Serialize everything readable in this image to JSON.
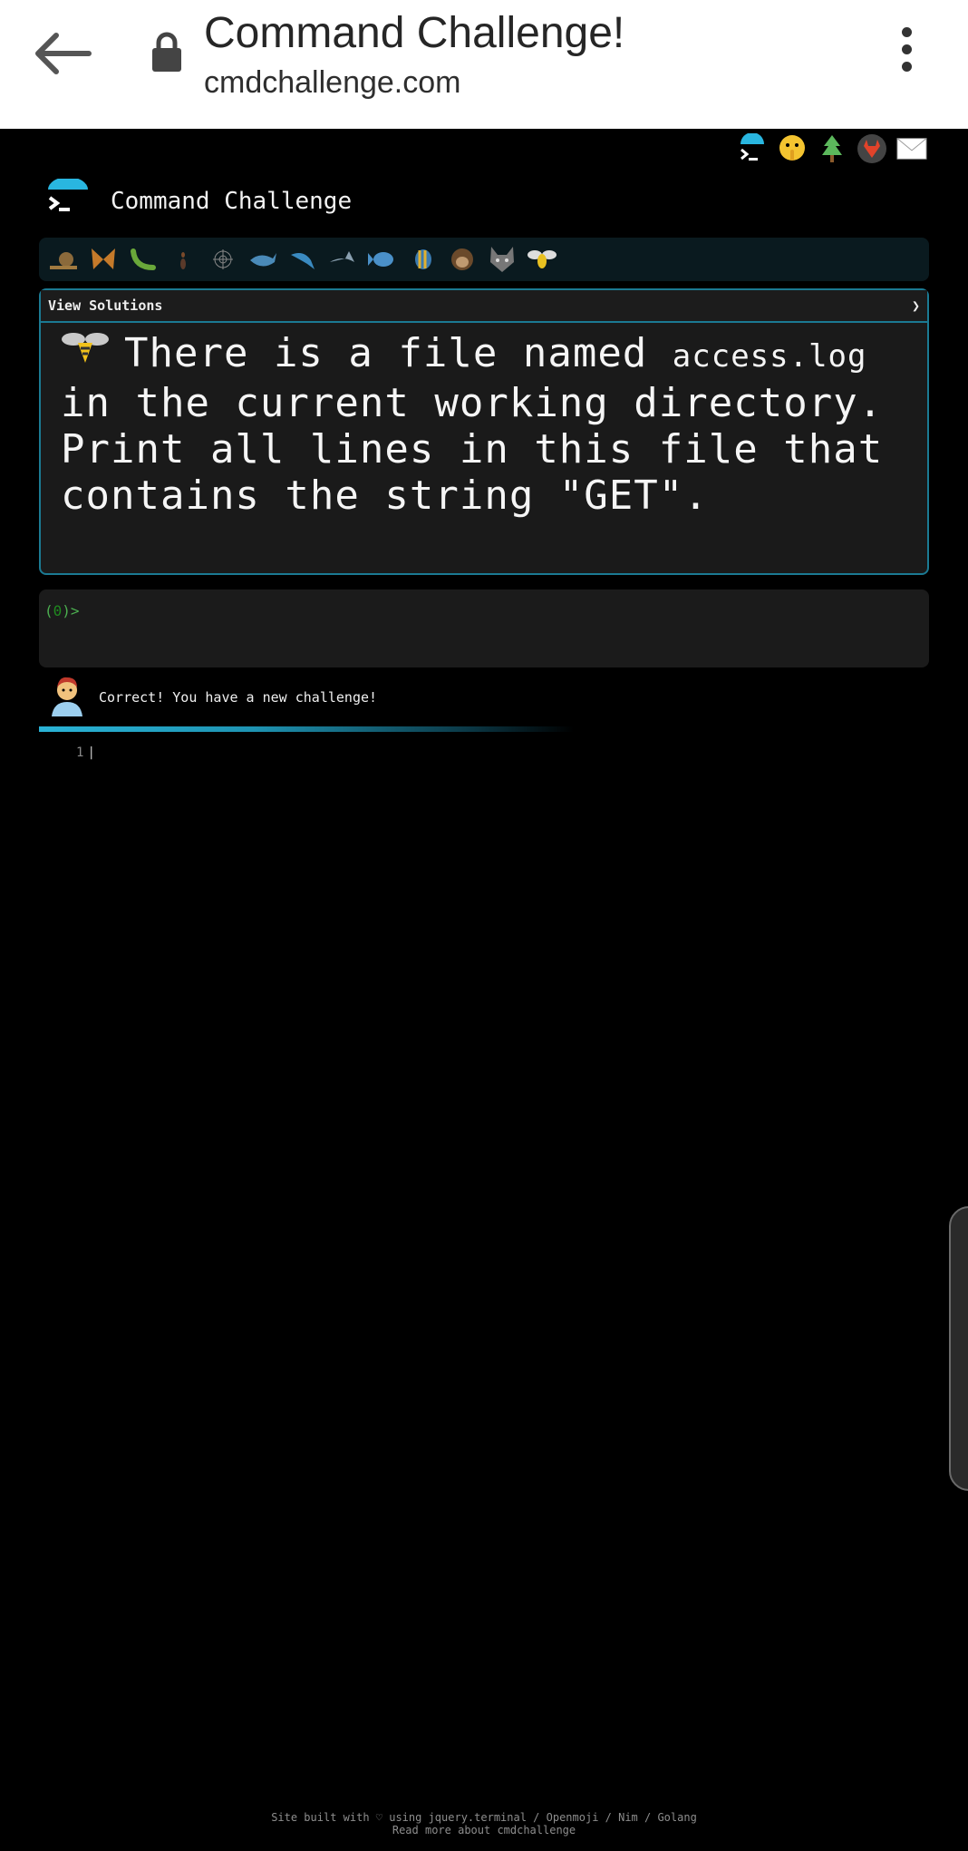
{
  "browser": {
    "title": "Command Challenge!",
    "url": "cmdchallenge.com"
  },
  "top_icons": [
    "terminal-icon",
    "shushing-face-icon",
    "tree-icon",
    "gitlab-icon",
    "mail-icon"
  ],
  "site": {
    "title": "Command Challenge"
  },
  "levels": [
    "snail-icon",
    "butterfly-icon",
    "caterpillar-icon",
    "ant-icon",
    "web-icon",
    "whale-icon",
    "dolphin-icon",
    "shark-icon",
    "fish-icon",
    "tropical-fish-icon",
    "monkey-icon",
    "wolf-icon",
    "bee-icon"
  ],
  "challenge": {
    "view_solutions": "View Solutions",
    "toggle": "❯",
    "text_before": "There is a file named ",
    "filename": "access.log",
    "text_after": " in the current working directory. Print all lines in this file that contains the string \"GET\"."
  },
  "terminal": {
    "prompt_open": "(",
    "prompt_count": "0",
    "prompt_close": ")>"
  },
  "feedback": {
    "message": "Correct! You have a new challenge!"
  },
  "editor": {
    "line_number": "1",
    "cursor": "|"
  },
  "footer": {
    "line1": "Site built with ♡ using jquery.terminal / Openmoji / Nim / Golang",
    "line2": "Read more about cmdchallenge"
  },
  "colors": {
    "accent": "#1b7a93",
    "prompt": "#4caf50",
    "progress": "#2ab3d6"
  }
}
